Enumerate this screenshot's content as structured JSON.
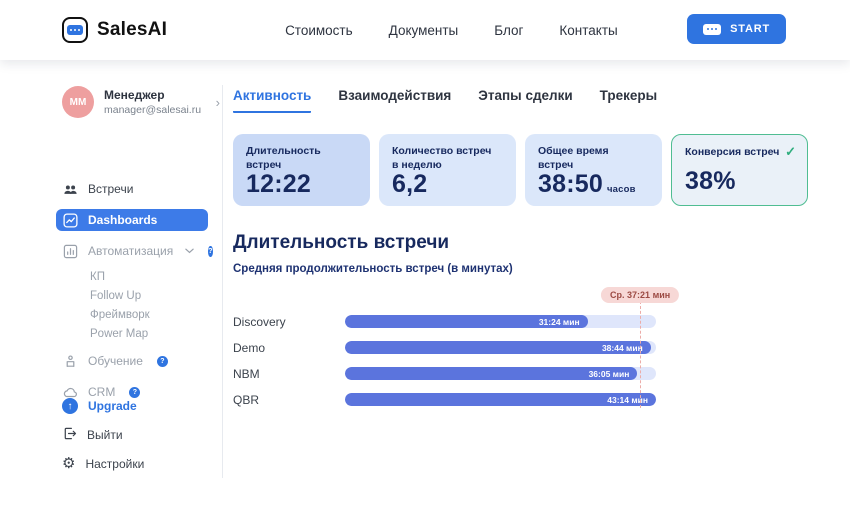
{
  "colors": {
    "primary_blue": "#2F74E0",
    "sidebar_active_blue": "#3D7BE8",
    "bar_blue": "#5B74DD",
    "bar_track": "#DFE6FB",
    "navy_text": "#17295E",
    "card_bg": "#DBE7FA",
    "card_highlight_bg": "#C9D9F6",
    "card_success_border": "#4FBD92",
    "avg_badge_bg": "#F7D8D6",
    "avg_badge_text": "#9C4A43",
    "avatar_pink": "#EE9F9F"
  },
  "topnav": {
    "brand": "SalesAI",
    "links": [
      "Стоимость",
      "Документы",
      "Блог",
      "Контакты"
    ],
    "start_button": "START"
  },
  "sidebar": {
    "user": {
      "initials": "MM",
      "name": "Менеджер",
      "email": "manager@salesai.ru",
      "chevron": "›"
    },
    "items": [
      {
        "label": "Встречи"
      },
      {
        "label": "Dashboards"
      },
      {
        "label": "Автоматизация",
        "badge": "?"
      }
    ],
    "sub_items": [
      "КП",
      "Follow Up",
      "Фреймворк",
      "Power Map"
    ],
    "secondary_items": [
      {
        "label": "Обучение",
        "badge": "?"
      },
      {
        "label": "CRM",
        "badge": "?"
      }
    ],
    "footer_items": [
      {
        "label": "Upgrade",
        "arrow": "↑"
      },
      {
        "label": "Выйти"
      },
      {
        "label": "Настройки",
        "gear": "⚙"
      }
    ]
  },
  "main": {
    "tabs": [
      {
        "label": "Активность"
      },
      {
        "label": "Взаимодействия"
      },
      {
        "label": "Этапы сделки"
      },
      {
        "label": "Трекеры"
      }
    ],
    "cards": [
      {
        "title": "Длительность встреч",
        "value": "12:22"
      },
      {
        "title": "Количество встреч в неделю",
        "value": "6,2"
      },
      {
        "title": "Общее время встреч",
        "value": "38:50",
        "unit": "часов"
      },
      {
        "title": "Конверсия встреч",
        "value": "38%",
        "check": "✓"
      }
    ]
  },
  "chart_data": {
    "type": "bar",
    "orientation": "horizontal",
    "title": "Длительность встречи",
    "subtitle": "Средняя продолжительность встреч (в минутах)",
    "categories": [
      "Discovery",
      "Demo",
      "NBM",
      "QBR"
    ],
    "values_minutes": [
      31.4,
      38.73,
      36.08,
      43.23
    ],
    "value_labels": [
      "31:24 мин",
      "38:44 мин",
      "36:05 мин",
      "43:14 мин"
    ],
    "percent": [
      78,
      98.3,
      94,
      100
    ],
    "xlim_minutes": [
      0,
      43.23
    ],
    "grid": false,
    "average": {
      "label": "Ср. 37:21 мин",
      "value_minutes": 37.35,
      "percent": 94.9
    }
  }
}
